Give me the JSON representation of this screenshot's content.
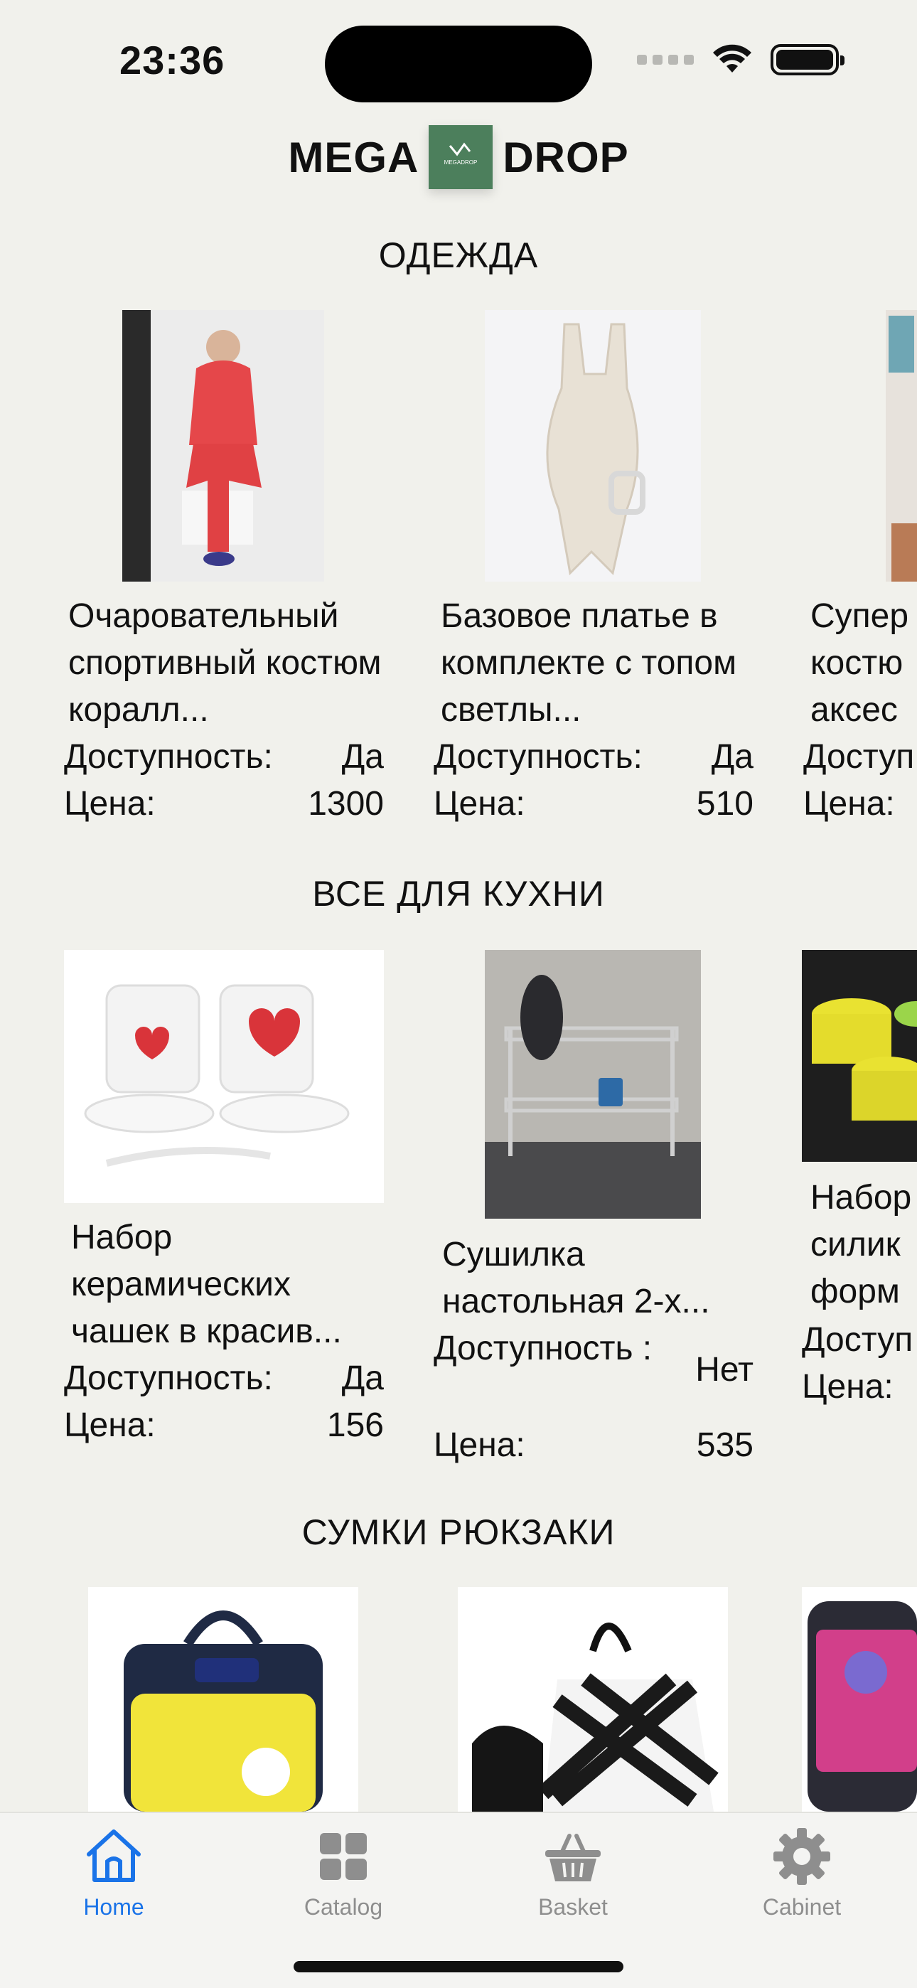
{
  "status_bar": {
    "time": "23:36"
  },
  "header": {
    "logo_left": "MEGA",
    "logo_right": "DROP",
    "logo_mark": "MEGADROP"
  },
  "sections": [
    {
      "title": "ОДЕЖДА",
      "items": [
        {
          "name": "Очаровательный спортивный костюм коралл...",
          "availability_label": "Доступность:",
          "availability": "Да",
          "price_label": "Цена:",
          "price": "1300"
        },
        {
          "name": "Базовое платье в комплекте с топом светлы...",
          "availability_label": "Доступность:",
          "availability": "Да",
          "price_label": "Цена:",
          "price": "510"
        },
        {
          "name": "Супер костю аксес",
          "availability_label": "Доступ",
          "price_label": "Цена:"
        }
      ]
    },
    {
      "title": "ВСЕ ДЛЯ КУХНИ",
      "items": [
        {
          "name": "Набор керамических чашек в красив...",
          "availability_label": "Доступность:",
          "availability": "Да",
          "price_label": "Цена:",
          "price": "156"
        },
        {
          "name": "Сушилка настольная 2-х...",
          "availability_label": "Доступность :",
          "availability": "Нет",
          "price_label": "Цена:",
          "price": "535"
        },
        {
          "name": "Набор силик форм",
          "availability_label": "Доступ",
          "price_label": "Цена:"
        }
      ]
    },
    {
      "title": "СУМКИ РЮКЗАКИ",
      "items": []
    }
  ],
  "tabs": [
    {
      "label": "Home",
      "icon": "home-icon",
      "active": true
    },
    {
      "label": "Catalog",
      "icon": "grid-icon",
      "active": false
    },
    {
      "label": "Basket",
      "icon": "basket-icon",
      "active": false
    },
    {
      "label": "Cabinet",
      "icon": "gear-icon",
      "active": false
    }
  ],
  "colors": {
    "accent": "#1a73e8",
    "background": "#f1f1ec",
    "logo_green": "#4c7f5c"
  }
}
